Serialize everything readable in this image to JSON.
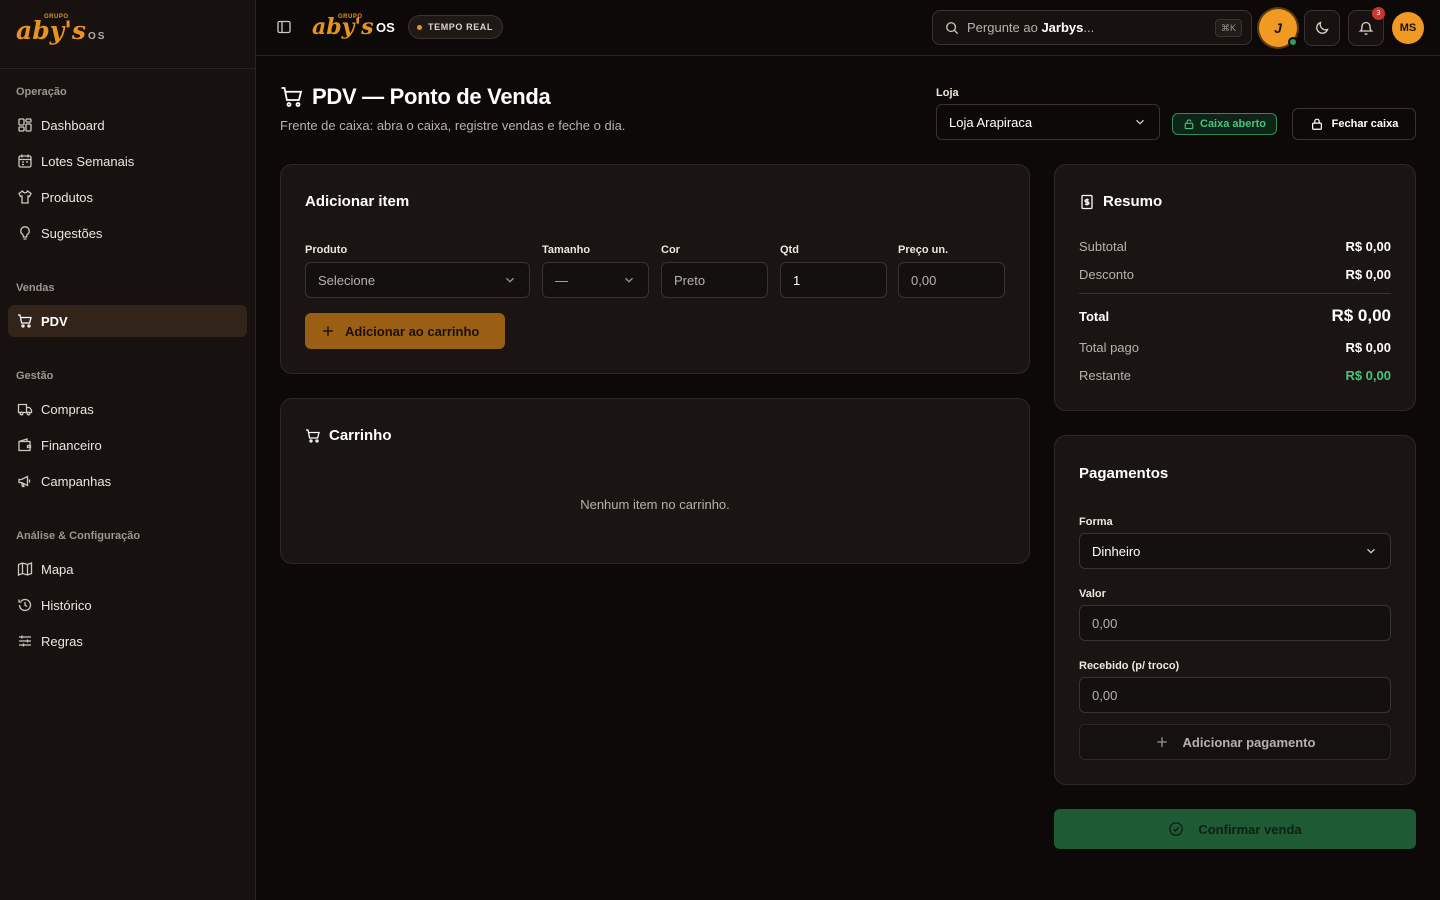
{
  "brand": {
    "group": "GRUPO",
    "name": "aby's",
    "suffix": "OS"
  },
  "sidebar": {
    "sections": [
      {
        "title": "Operação",
        "items": [
          "Dashboard",
          "Lotes Semanais",
          "Produtos",
          "Sugestões"
        ]
      },
      {
        "title": "Vendas",
        "items": [
          "PDV"
        ]
      },
      {
        "title": "Gestão",
        "items": [
          "Compras",
          "Financeiro",
          "Campanhas"
        ]
      },
      {
        "title": "Análise & Configuração",
        "items": [
          "Mapa",
          "Histórico",
          "Regras"
        ]
      }
    ],
    "active_item": "PDV"
  },
  "topbar": {
    "os_label": "OS",
    "realtime_badge": "TEMPO REAL",
    "search_prefix": "Pergunte ao ",
    "search_name": "Jarbys",
    "search_suffix": "...",
    "search_shortcut": "⌘K",
    "assistant_initial": "J",
    "notification_count": "3",
    "user_initials": "MS"
  },
  "page": {
    "title": "PDV — Ponto de Venda",
    "subtitle": "Frente de caixa: abra o caixa, registre vendas e feche o dia.",
    "store_label": "Loja",
    "store_value": "Loja Arapiraca",
    "cash_status": "Caixa aberto",
    "close_cash_button": "Fechar caixa"
  },
  "add_item": {
    "title": "Adicionar item",
    "fields": {
      "produto": {
        "label": "Produto",
        "value": "Selecione"
      },
      "tamanho": {
        "label": "Tamanho",
        "value": "—"
      },
      "cor": {
        "label": "Cor",
        "placeholder": "Preto"
      },
      "qtd": {
        "label": "Qtd",
        "value": "1"
      },
      "preco": {
        "label": "Preço un.",
        "placeholder": "0,00"
      }
    },
    "add_button": "Adicionar ao carrinho"
  },
  "cart": {
    "title": "Carrinho",
    "empty_message": "Nenhum item no carrinho."
  },
  "summary": {
    "title": "Resumo",
    "subtotal_label": "Subtotal",
    "subtotal": "R$ 0,00",
    "discount_label": "Desconto",
    "discount": "R$ 0,00",
    "total_label": "Total",
    "total": "R$ 0,00",
    "paid_label": "Total pago",
    "paid": "R$ 0,00",
    "remaining_label": "Restante",
    "remaining": "R$ 0,00"
  },
  "payments": {
    "title": "Pagamentos",
    "method_label": "Forma",
    "method_value": "Dinheiro",
    "amount_label": "Valor",
    "amount_placeholder": "0,00",
    "received_label": "Recebido (p/ troco)",
    "received_placeholder": "0,00",
    "add_button": "Adicionar pagamento"
  },
  "confirm_button": "Confirmar venda",
  "colors": {
    "accent": "#f09a24",
    "success": "#45c47a",
    "background": "#0d0908",
    "card": "#1a1513"
  }
}
